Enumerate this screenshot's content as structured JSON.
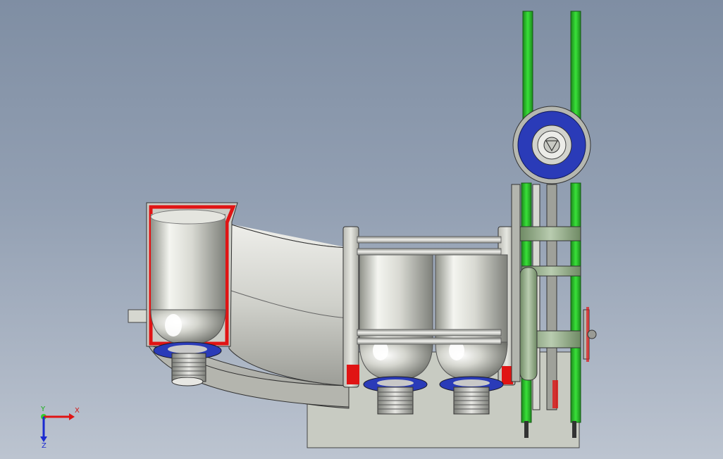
{
  "viewport": {
    "background_top": "#7f8ea3",
    "background_bottom": "#bcc4d0"
  },
  "colors": {
    "body_gray": "#c9cbc4",
    "cut_red": "#e01414",
    "frame_green": "#2fd12f",
    "frame_green_dark": "#1c8a1c",
    "seal_blue": "#2a3bb8",
    "bolt_silver": "#c8c8c8"
  },
  "triad": {
    "x_label": "X",
    "y_label": "Y",
    "z_label": "Z",
    "x_color": "#e01414",
    "y_color": "#18b018",
    "z_color": "#1a2ad0"
  }
}
